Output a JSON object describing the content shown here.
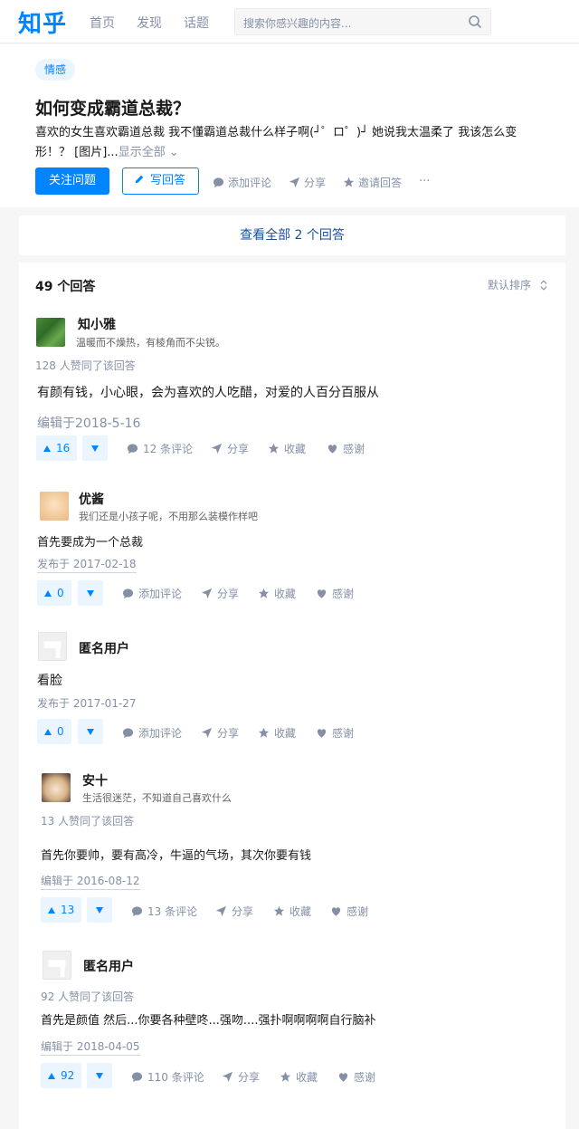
{
  "header": {
    "logo": "知乎",
    "nav": [
      "首页",
      "发现",
      "话题"
    ],
    "search_placeholder": "搜索你感兴趣的内容..."
  },
  "question": {
    "topic": "情感",
    "title": "如何变成霸道总裁？",
    "detail": "喜欢的女生喜欢霸道总裁 我不懂霸道总裁什么样子啊(┘゜ロ゜)┘ 她说我太温柔了 我该怎么变形！？ [图片]...",
    "show_all": "显示全部",
    "follow_label": "关注问题",
    "write_answer_label": "写回答",
    "actions": [
      "添加评论",
      "分享",
      "邀请回答"
    ],
    "more": "···"
  },
  "view_all": "查看全部 2 个回答",
  "answers_header": {
    "count_label": "49 个回答",
    "sort_label": "默认排序"
  },
  "answers": [
    {
      "name": "知小雅",
      "bio": "温暖而不燥热，有棱角而不尖锐。",
      "votes_text": "128 人赞同了该回答",
      "content": "有颜有钱，小心眼，会为喜欢的人吃醋，对爱的人百分百服从",
      "date": "编辑于2018-5-16",
      "upvotes": "16",
      "actions": [
        "12 条评论",
        "分享",
        "收藏",
        "感谢"
      ]
    },
    {
      "name": "优酱",
      "bio": "我们还是小孩子呢，不用那么装模作样吧",
      "votes_text": "",
      "content": "首先要成为一个总裁",
      "date": "发布于 2017-02-18",
      "upvotes": "0",
      "actions": [
        "添加评论",
        "分享",
        "收藏",
        "感谢"
      ]
    },
    {
      "name": "匿名用户",
      "bio": "",
      "votes_text": "",
      "content": "看脸",
      "date": "发布于 2017-01-27",
      "upvotes": "0",
      "actions": [
        "添加评论",
        "分享",
        "收藏",
        "感谢"
      ]
    },
    {
      "name": "安十",
      "bio": "生活很迷茫，不知道自己喜欢什么",
      "votes_text": "13 人赞同了该回答",
      "content": "首先你要帅，要有高冷，牛逼的气场，其次你要有钱",
      "date": "编辑于 2016-08-12",
      "upvotes": "13",
      "actions": [
        "13 条评论",
        "分享",
        "收藏",
        "感谢"
      ]
    },
    {
      "name": "匿名用户",
      "bio": "",
      "votes_text": "92 人赞同了该回答",
      "content": "首先是颜值 然后...你要各种壁咚...强吻....强扑啊啊啊啊自行脑补",
      "date": "编辑于 2018-04-05",
      "upvotes": "92",
      "actions": [
        "110 条评论",
        "分享",
        "收藏",
        "感谢"
      ]
    }
  ],
  "colors": {
    "brand": "#0084ff",
    "muted": "#8590a6",
    "link": "#175199",
    "vote_bg": "#ebf5ff"
  }
}
